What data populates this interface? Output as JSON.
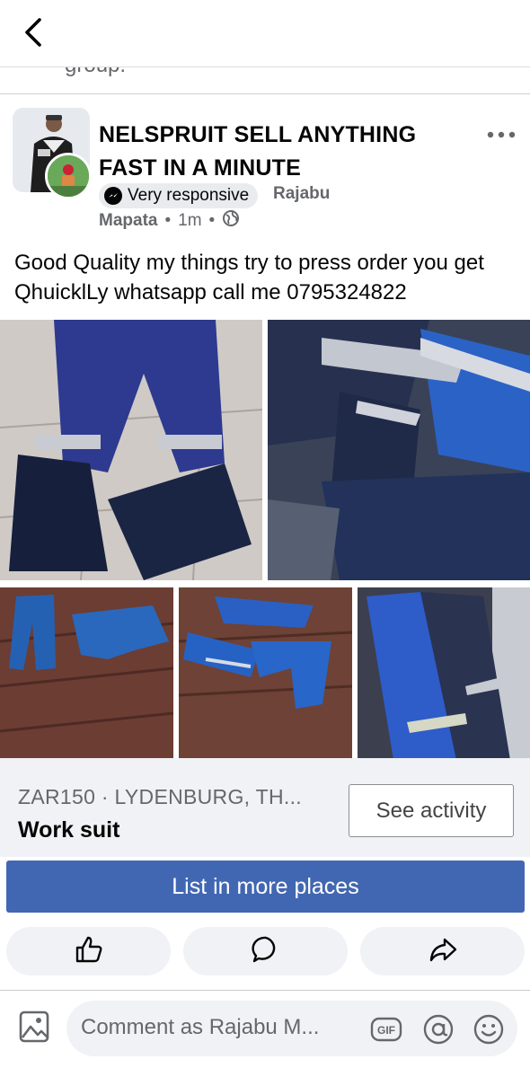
{
  "header": {
    "back_icon": "chevron-left-icon"
  },
  "previous_post": {
    "snippet": "group."
  },
  "post": {
    "group_name": "NELSPRUIT SELL ANYTHING FAST IN A MINUTE",
    "badge_label": "Very responsive",
    "badge_icon": "messenger-icon",
    "author_first": "Rajabu",
    "author_last": "Mapata",
    "time": "1m",
    "separator": "•",
    "audience_icon": "globe-icon",
    "body_text": "Good Quality my things try to press order you get QhuicklLy whatsapp call me 0795324822",
    "more_icon": "more-options-icon"
  },
  "listing": {
    "price_location": "ZAR150 · LYDENBURG, TH...",
    "title": "Work suit",
    "see_activity_label": "See activity"
  },
  "list_more_label": "List in more places",
  "actions": {
    "like_icon": "like-icon",
    "comment_icon": "comment-icon",
    "share_icon": "share-icon"
  },
  "comment_bar": {
    "placeholder": "Comment as Rajabu M...",
    "photo_icon": "photo-icon",
    "gif_label": "GIF",
    "mention_icon": "at-sign-icon",
    "emoji_icon": "emoji-icon"
  }
}
